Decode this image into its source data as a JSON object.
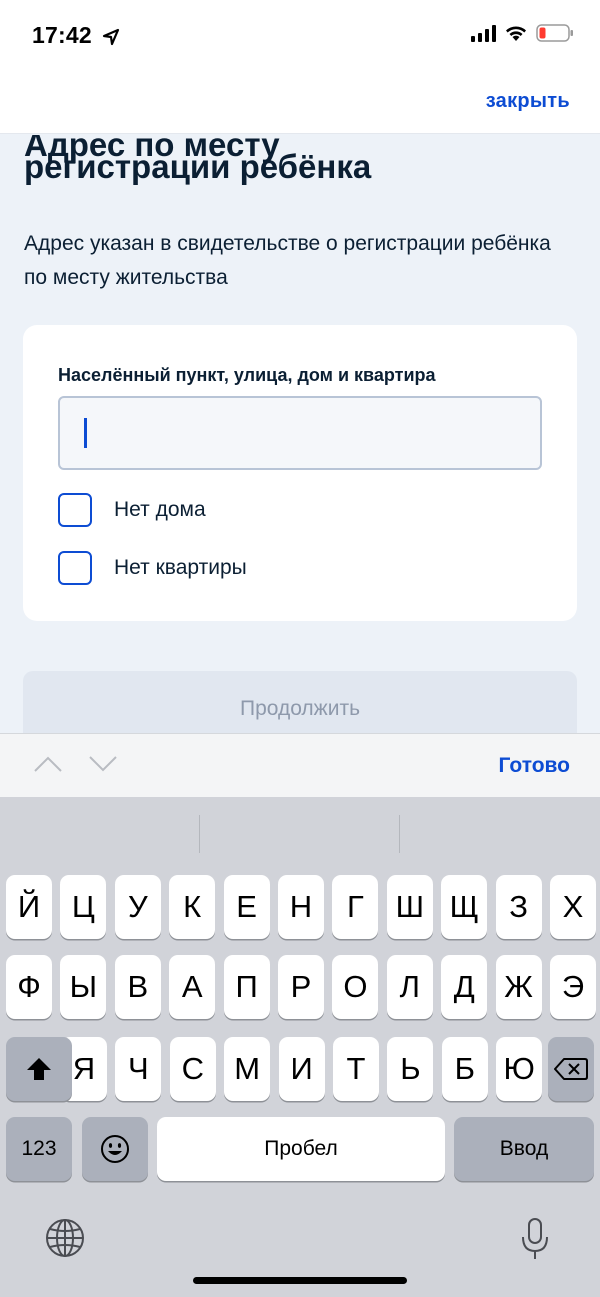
{
  "status_bar": {
    "time": "17:42"
  },
  "header": {
    "close_label": "закрыть"
  },
  "content": {
    "title_partial": "Адрес по месту",
    "title": "регистрации ребёнка",
    "subtitle": "Адрес указан в свидетельстве о регистрации ребёнка по месту жительства",
    "field_label": "Населённый пункт, улица, дом и квартира",
    "field_value": "",
    "checkbox_no_house": "Нет дома",
    "checkbox_no_apartment": "Нет квартиры",
    "continue_label": "Продолжить"
  },
  "accessory": {
    "done_label": "Готово"
  },
  "keyboard": {
    "row1": [
      "Й",
      "Ц",
      "У",
      "К",
      "Е",
      "Н",
      "Г",
      "Ш",
      "Щ",
      "З",
      "Х"
    ],
    "row2": [
      "Ф",
      "Ы",
      "В",
      "А",
      "П",
      "Р",
      "О",
      "Л",
      "Д",
      "Ж",
      "Э"
    ],
    "row3": [
      "Я",
      "Ч",
      "С",
      "М",
      "И",
      "Т",
      "Ь",
      "Б",
      "Ю"
    ],
    "numbers_key": "123",
    "space_key": "Пробел",
    "return_key": "Ввод"
  },
  "colors": {
    "accent": "#0d4cd3",
    "background": "#edf2f8",
    "keyboard_bg": "#d1d3d9"
  }
}
